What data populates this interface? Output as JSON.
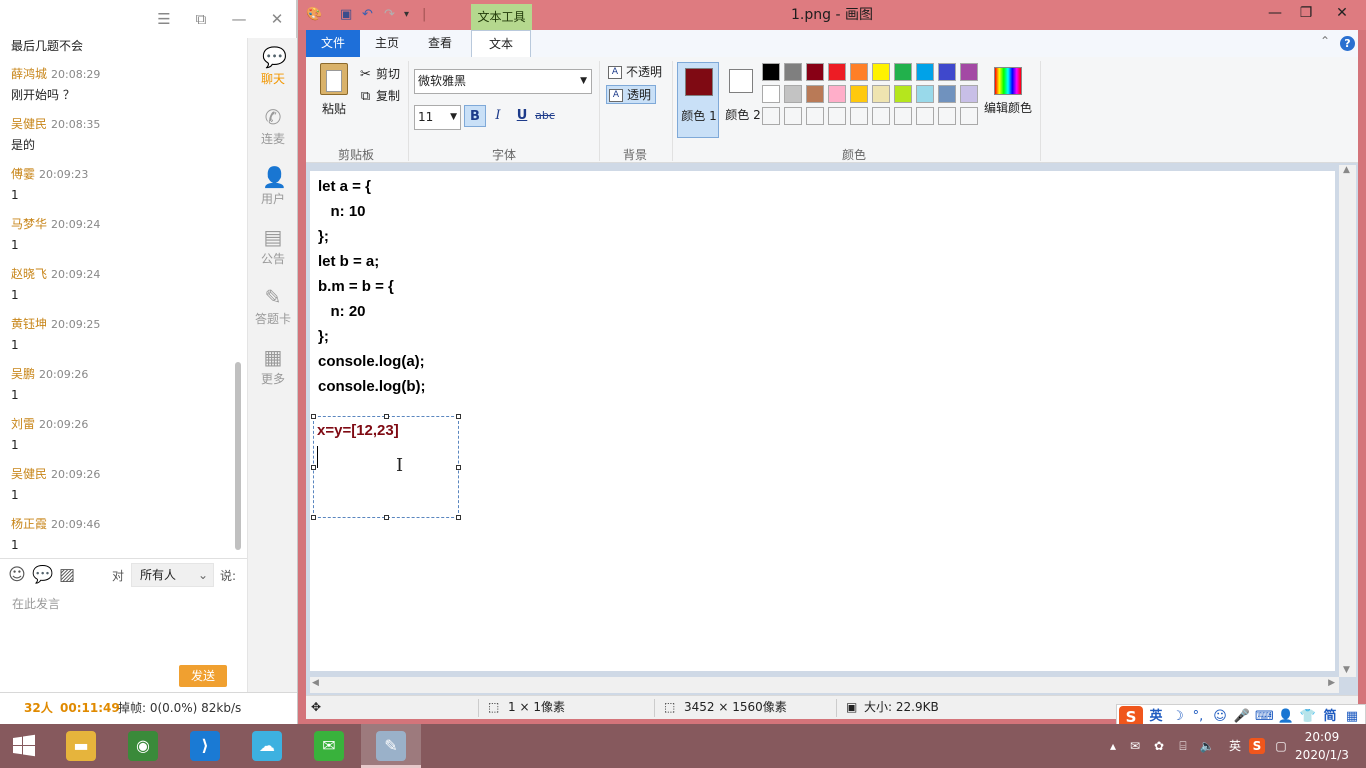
{
  "chat": {
    "window_controls": [
      "☰",
      "⧉",
      "—",
      "✕"
    ],
    "messages": [
      {
        "sender": "",
        "time": "",
        "text": "最后几题不会"
      },
      {
        "sender": "薛鸿城",
        "time": "20:08:29",
        "text": "刚开始吗  ？"
      },
      {
        "sender": "吴健民",
        "time": "20:08:35",
        "text": "是的"
      },
      {
        "sender": "傅霎",
        "time": "20:09:23",
        "text": "1"
      },
      {
        "sender": "马梦华",
        "time": "20:09:24",
        "text": "1"
      },
      {
        "sender": "赵晓飞",
        "time": "20:09:24",
        "text": "1"
      },
      {
        "sender": "黄钰坤",
        "time": "20:09:25",
        "text": "1"
      },
      {
        "sender": "吴鹏",
        "time": "20:09:26",
        "text": "1"
      },
      {
        "sender": "刘雷",
        "time": "20:09:26",
        "text": "1"
      },
      {
        "sender": "吴健民",
        "time": "20:09:26",
        "text": "1"
      },
      {
        "sender": "杨正霞",
        "time": "20:09:46",
        "text": "1"
      }
    ],
    "tools": [
      {
        "label": "聊天",
        "icon": "chat-bubble-icon",
        "glyph": "💬",
        "active": true
      },
      {
        "label": "连麦",
        "icon": "phone-icon",
        "glyph": "✆",
        "active": false
      },
      {
        "label": "用户",
        "icon": "user-icon",
        "glyph": "👤",
        "active": false
      },
      {
        "label": "公告",
        "icon": "notice-icon",
        "glyph": "▤",
        "active": false
      },
      {
        "label": "答题卡",
        "icon": "answer-card-icon",
        "glyph": "✎",
        "active": false
      },
      {
        "label": "更多",
        "icon": "more-icon",
        "glyph": "▦",
        "active": false
      }
    ],
    "input": {
      "to_label": "对",
      "to_value": "所有人",
      "say_label": "说:",
      "placeholder": "在此发言",
      "send_label": "发送"
    },
    "status": {
      "people": "32人",
      "duration": "00:11:49",
      "drop_label": "掉帧: 0(0.0%) 82kb/s"
    }
  },
  "paint": {
    "title": "1.png - 画图",
    "context_tab": "文本工具",
    "tabs": [
      "文件",
      "主页",
      "查看",
      "文本"
    ],
    "clipboard": {
      "paste": "粘贴",
      "cut": "剪切",
      "copy": "复制",
      "group": "剪贴板"
    },
    "font": {
      "name": "微软雅黑",
      "size": "11",
      "group": "字体",
      "bold": "B",
      "italic": "I",
      "underline": "U",
      "strike": "abc"
    },
    "background": {
      "opaque": "不透明",
      "transparent": "透明",
      "group": "背景"
    },
    "colors": {
      "color1_label": "颜色 1",
      "color2_label": "颜色 2",
      "color1": "#7f0a13",
      "color2": "#ffffff",
      "edit_label": "编辑颜色",
      "group": "颜色",
      "palette_row1": [
        "#000000",
        "#7f7f7f",
        "#880015",
        "#ed1c24",
        "#ff7f27",
        "#fff200",
        "#22b14c",
        "#00a2e8",
        "#3f48cc",
        "#a349a4"
      ],
      "palette_row2": [
        "#ffffff",
        "#c3c3c3",
        "#b97a57",
        "#ffaec9",
        "#ffc90e",
        "#efe4b0",
        "#b5e61d",
        "#99d9ea",
        "#7092be",
        "#c8bfe7"
      ]
    },
    "code_lines": [
      "let a = {",
      "   n: 10",
      "};",
      "let b = a;",
      "b.m = b = {",
      "   n: 20",
      "};",
      "console.log(a);",
      "console.log(b);"
    ],
    "typed_text": "x=y=[12,23]",
    "status": {
      "selection": "1 × 1像素",
      "image_size": "3452 × 1560像素",
      "file_size": "大小: 22.9KB"
    }
  },
  "ime": {
    "mode": "英"
  },
  "taskbar": {
    "apps": [
      {
        "name": "file-explorer",
        "glyph": "▬",
        "color": "#e6b43c"
      },
      {
        "name": "chrome",
        "glyph": "◉",
        "color": "#3a8a3a"
      },
      {
        "name": "vscode",
        "glyph": "⟩",
        "color": "#1a7ad4"
      },
      {
        "name": "classroom",
        "glyph": "☁",
        "color": "#3db1e0"
      },
      {
        "name": "wechat",
        "glyph": "✉",
        "color": "#39b23c"
      },
      {
        "name": "paint",
        "glyph": "✎",
        "color": "#9ab1c9"
      }
    ],
    "tray_lang": "英",
    "time": "20:09",
    "date": "2020/1/3"
  }
}
